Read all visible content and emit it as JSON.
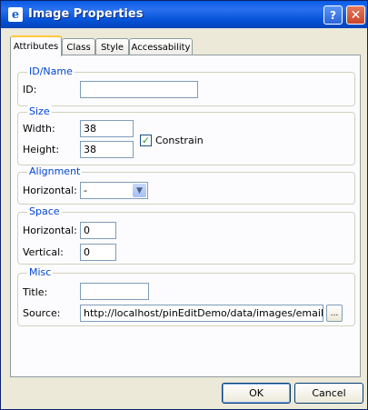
{
  "window": {
    "title": "Image Properties",
    "help_label": "?",
    "close_label": "✕"
  },
  "tabs": [
    "Attributes",
    "Class",
    "Style",
    "Accessability"
  ],
  "groups": {
    "id_name": {
      "legend": "ID/Name",
      "id_label": "ID:",
      "id_value": ""
    },
    "size": {
      "legend": "Size",
      "width_label": "Width:",
      "width_value": "38",
      "height_label": "Height:",
      "height_value": "38",
      "constrain_label": "Constrain",
      "constrain_checked": true
    },
    "alignment": {
      "legend": "Alignment",
      "horizontal_label": "Horizontal:",
      "horizontal_value": "-"
    },
    "space": {
      "legend": "Space",
      "horizontal_label": "Horizontal:",
      "horizontal_value": "0",
      "vertical_label": "Vertical:",
      "vertical_value": "0"
    },
    "misc": {
      "legend": "Misc",
      "title_label": "Title:",
      "title_value": "",
      "source_label": "Source:",
      "source_value": "http://localhost/pinEditDemo/data/images/email.gif",
      "browse_label": "..."
    }
  },
  "buttons": {
    "ok": "OK",
    "cancel": "Cancel"
  }
}
